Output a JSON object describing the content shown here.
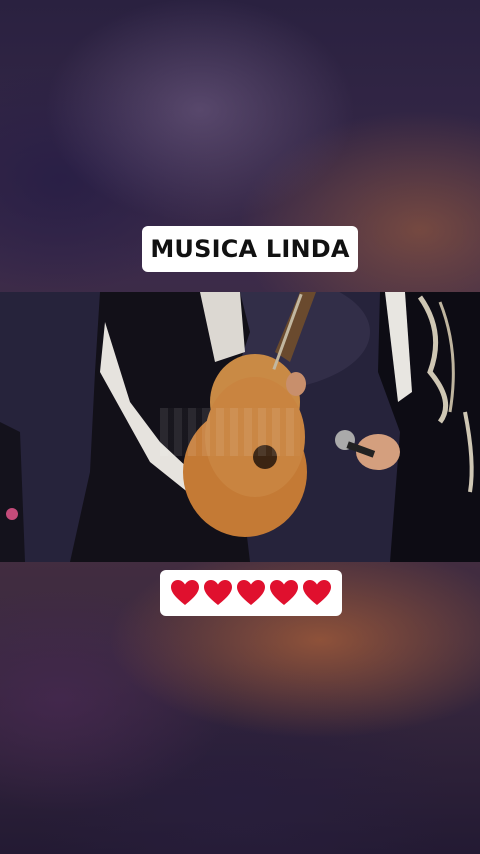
{
  "caption": {
    "title": "MUSICA LINDA",
    "hearts": [
      "heart-icon",
      "heart-icon",
      "heart-icon",
      "heart-icon",
      "heart-icon"
    ],
    "heart_color": "#e0102e"
  },
  "video": {
    "description_icon": "video-frame"
  }
}
